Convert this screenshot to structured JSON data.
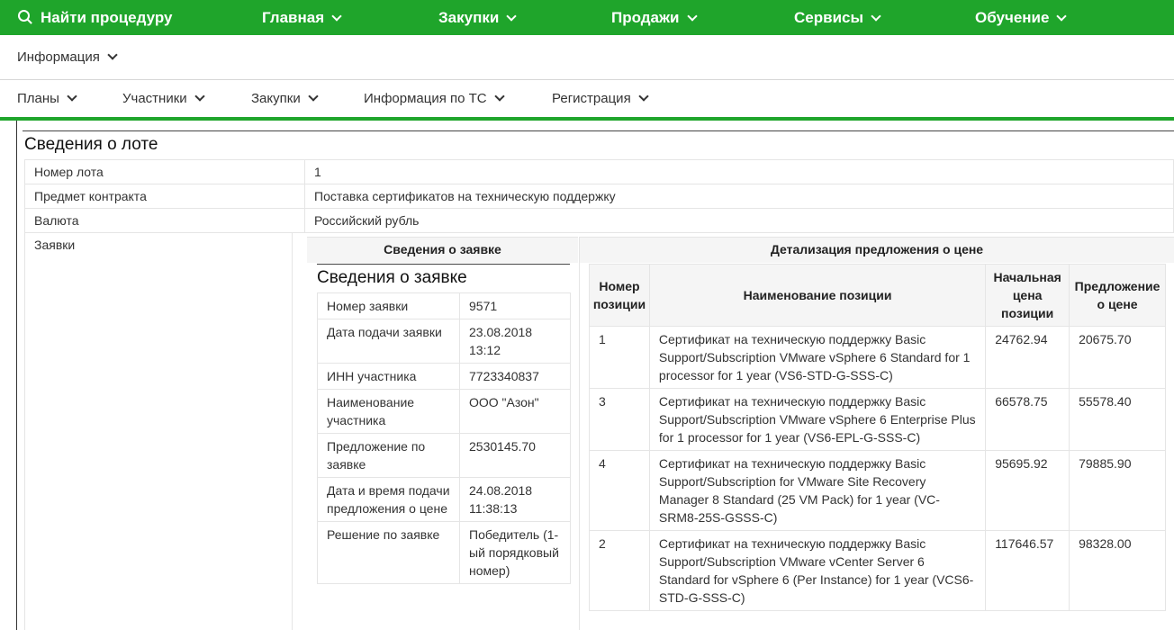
{
  "topnav": {
    "search": "Найти процедуру",
    "items": [
      "Главная",
      "Закупки",
      "Продажи",
      "Сервисы",
      "Обучение"
    ]
  },
  "subnav1": [
    "Информация"
  ],
  "subnav2": [
    "Планы",
    "Участники",
    "Закупки",
    "Информация по ТС",
    "Регистрация"
  ],
  "lot": {
    "title": "Сведения о лоте",
    "rows": [
      {
        "label": "Номер лота",
        "value": "1"
      },
      {
        "label": "Предмет контракта",
        "value": "Поставка сертификатов на техническую поддержку"
      },
      {
        "label": "Валюта",
        "value": "Российский рубль"
      }
    ],
    "applications_label": "Заявки"
  },
  "applications": {
    "col1_header": "Сведения о заявке",
    "col2_header": "Детализация предложения о цене",
    "app_title": "Сведения о заявке",
    "app_rows": [
      {
        "label": "Номер заявки",
        "value": "9571"
      },
      {
        "label": "Дата подачи заявки",
        "value": "23.08.2018 13:12"
      },
      {
        "label": "ИНН участника",
        "value": "7723340837"
      },
      {
        "label": "Наименование участника",
        "value": "ООО \"Азон\""
      },
      {
        "label": "Предложение по заявке",
        "value": "2530145.70"
      },
      {
        "label": "Дата и время подачи предложения о цене",
        "value": "24.08.2018 11:38:13"
      },
      {
        "label": "Решение по заявке",
        "value": "Победитель (1-ый порядковый номер)"
      }
    ],
    "positions_headers": [
      "Номер позиции",
      "Наименование позиции",
      "Начальная цена позиции",
      "Предложение о цене"
    ],
    "positions": [
      {
        "num": "1",
        "name": "Сертификат на техническую поддержку Basic Support/Subscription VMware vSphere 6 Standard for 1 processor for 1 year (VS6-STD-G-SSS-C)",
        "start": "24762.94",
        "offer": "20675.70"
      },
      {
        "num": "3",
        "name": "Сертификат на техническую поддержку Basic Support/Subscription VMware vSphere 6 Enterprise Plus for 1 processor for 1 year (VS6-EPL-G-SSS-C)",
        "start": "66578.75",
        "offer": "55578.40"
      },
      {
        "num": "4",
        "name": "Сертификат на техническую поддержку Basic Support/Subscription for VMware Site Recovery Manager 8 Standard (25 VM Pack) for 1 year (VC-SRM8-25S-GSSS-C)",
        "start": "95695.92",
        "offer": "79885.90"
      },
      {
        "num": "2",
        "name": "Сертификат на техническую поддержку Basic Support/Subscription VMware vCenter Server 6 Standard for vSphere 6 (Per Instance) for 1 year (VCS6-STD-G-SSS-C)",
        "start": "117646.57",
        "offer": "98328.00"
      }
    ]
  },
  "colors": {
    "accent": "#1fa52b"
  }
}
